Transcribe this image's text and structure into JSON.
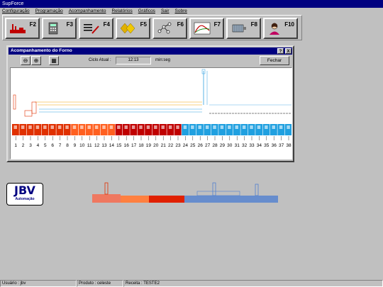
{
  "app": {
    "title": "SupForce"
  },
  "menu": [
    "Configuração",
    "Programação",
    "Acompanhamento",
    "Relatórios",
    "Gráficos",
    "Sair",
    "Sobre"
  ],
  "toolbar": {
    "buttons": [
      {
        "key": "F2",
        "icon": "kiln-icon"
      },
      {
        "key": "F3",
        "icon": "calculator-icon"
      },
      {
        "key": "F4",
        "icon": "settings-list-icon"
      },
      {
        "key": "F5",
        "icon": "diamonds-icon"
      },
      {
        "key": "F6",
        "icon": "network-icon"
      },
      {
        "key": "F7",
        "icon": "curve-chart-icon"
      },
      {
        "key": "F8",
        "icon": "motor-icon"
      },
      {
        "key": "F10",
        "icon": "person-icon"
      }
    ]
  },
  "kiln_window": {
    "title": "Acompanhamento do Forno",
    "help_label": "?",
    "close_label": "X",
    "cycle_label": "Ciclo Atual :",
    "cycle_value": "12:13",
    "cycle_unit": "min:seg",
    "close_button": "Fechar",
    "positions": [
      "1",
      "2",
      "3",
      "4",
      "5",
      "6",
      "7",
      "8",
      "9",
      "10",
      "11",
      "12",
      "13",
      "14",
      "15",
      "16",
      "17",
      "18",
      "19",
      "20",
      "21",
      "22",
      "23",
      "24",
      "25",
      "26",
      "27",
      "28",
      "29",
      "30",
      "31",
      "32",
      "33",
      "34",
      "35",
      "36",
      "37",
      "38"
    ]
  },
  "logo": {
    "main": "JBV",
    "sub": "Automação"
  },
  "status": {
    "user": "Usuário : jbv",
    "product": "Produto : celeste",
    "recipe": "Receita : TESTE2"
  },
  "colors": {
    "hot": "#e03000",
    "mid": "#ff6020",
    "cool": "#20a0e0",
    "dark_red": "#c00000"
  }
}
